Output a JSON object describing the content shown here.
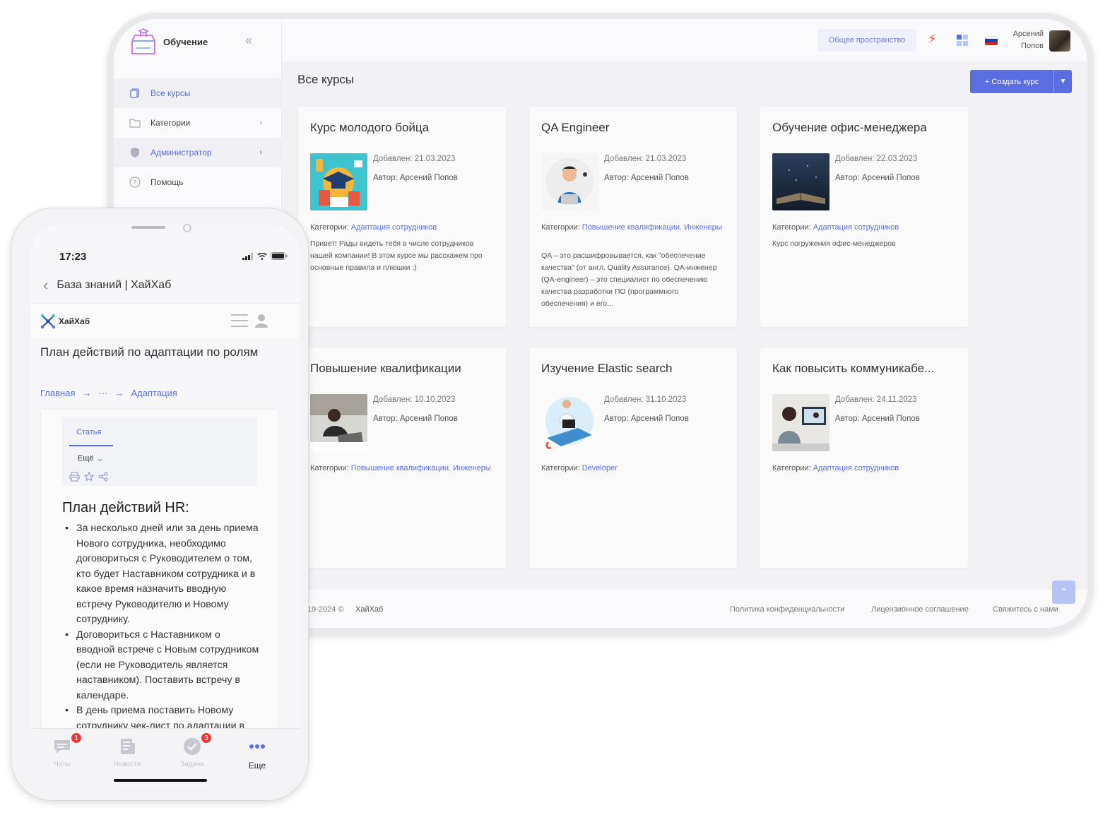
{
  "app": {
    "title": "Обучение",
    "collapse_icon": "double-chevron-left-icon"
  },
  "sidebar": {
    "items": [
      {
        "label": "Все курсы",
        "icon": "copy-icon",
        "active": true
      },
      {
        "label": "Категории",
        "icon": "folder-icon",
        "has_chevron": true
      },
      {
        "label": "Администратор",
        "icon": "shield-icon",
        "has_chevron": true,
        "highlighted": true
      },
      {
        "label": "Помощь",
        "icon": "help-icon"
      }
    ]
  },
  "topbar": {
    "workspace_button": "Общее пространство",
    "user_first": "Арсений",
    "user_last": "Попов"
  },
  "page": {
    "title": "Все курсы",
    "create_button": "+ Создать курс"
  },
  "labels": {
    "added_prefix": "Добавлен: ",
    "author_prefix": "Автор: ",
    "categories_prefix": "Категории: "
  },
  "courses": [
    {
      "title": "Курс молодого бойца",
      "added": "21.03.2023",
      "author": "Арсений Попов",
      "categories": "Адаптация сотрудников",
      "description": "Привет! Рады видеть тебя в числе сотрудников нашей компании! В этом курсе мы расскажем про основные правила и плюшки :)"
    },
    {
      "title": "QA Engineer",
      "added": "21.03.2023",
      "author": "Арсений Попов",
      "categories": "Повышение квалификации. Инженеры",
      "description": "QA – это расшифровывается, как \"обеспечение качества\" (от англ. Quality Assurance). QA-инженер (QA-engineer) – это специалист по обеспечению качества разработки ПО (программного обеспечения) и его..."
    },
    {
      "title": "Обучение офис-менеджера",
      "added": "22.03.2023",
      "author": "Арсений Попов",
      "categories": "Адаптация сотрудников",
      "description": "Курс погружения офис-менеджеров"
    },
    {
      "title": "Повышение квалификации",
      "added": "10.10.2023",
      "author": "Арсений Попов",
      "categories": "Повышение квалификации. Инженеры",
      "description": ""
    },
    {
      "title": "Изучение Elastic search",
      "added": "31.10.2023",
      "author": "Арсений Попов",
      "categories": "Developer",
      "description": ""
    },
    {
      "title": "Как повысить коммуникабе...",
      "added": "24.11.2023",
      "author": "Арсений Попов",
      "categories": "Адаптация сотрудников",
      "description": ""
    }
  ],
  "footer": {
    "copyright": "19-2024 ©",
    "brand": "ХайХаб",
    "links": [
      "Политика конфиденциальности",
      "Лицензионное соглашение",
      "Свяжитесь с нами"
    ]
  },
  "phone": {
    "time": "17:23",
    "back_title": "База знаний | ХайХаб",
    "brand": "ХайХаб",
    "article_title": "План действий по адаптации по ролям",
    "breadcrumbs": [
      "Главная",
      "···",
      "Адаптация"
    ],
    "tab_article": "Статья",
    "tab_more": "Ещё",
    "section_title": "План действий HR:",
    "bullets": [
      "За несколько дней или за день приема Нового сотрудника, необходимо договориться с Руководителем о том, кто будет Наставником сотрудника и в какое время назначить вводную встречу Руководителю и Новому сотруднику.",
      "Договориться с Наставником о вводной встрече с Новым сотрудником (если не Руководитель является наставником). Поставить встречу в календаре.",
      "В день приема поставить Новому сотруднику чек-лист по адаптации в"
    ],
    "tabbar": [
      {
        "label": "Чаты",
        "badge": "1",
        "icon": "chat-icon"
      },
      {
        "label": "Новости",
        "badge": "",
        "icon": "news-icon"
      },
      {
        "label": "Задачи",
        "badge": "3",
        "icon": "check-circle-icon"
      },
      {
        "label": "Еще",
        "badge": "",
        "icon": "more-dots-icon",
        "active": true
      }
    ]
  },
  "colors": {
    "accent": "#5b6ee1",
    "bolt": "#f05a28",
    "badge": "#e53b3b"
  }
}
